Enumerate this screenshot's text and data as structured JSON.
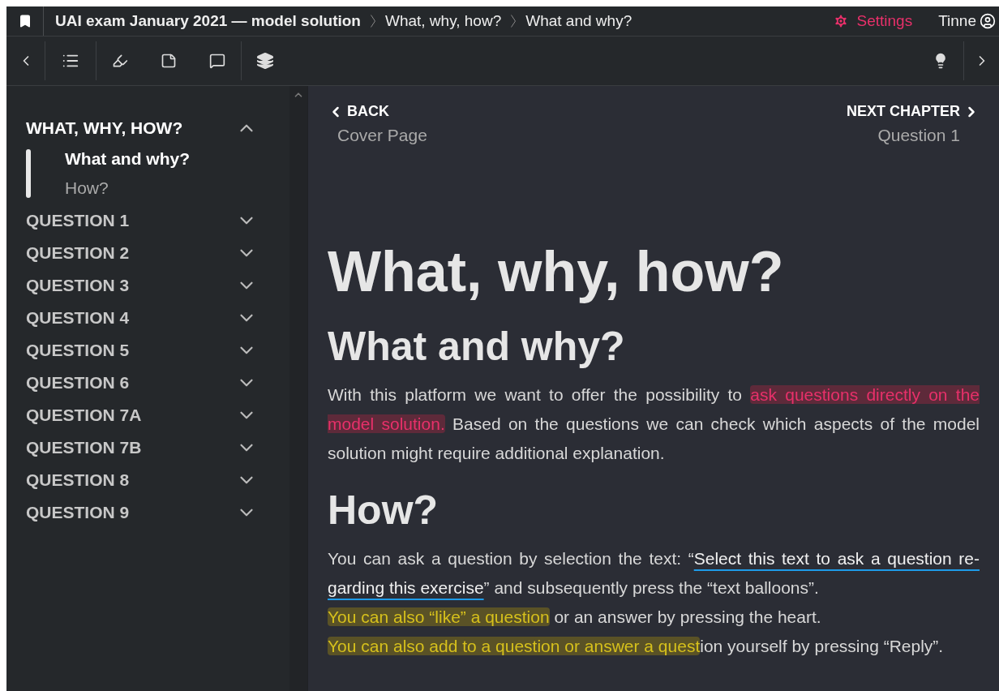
{
  "topbar": {
    "title": "UAI exam January 2021 — model solution",
    "breadcrumbs": [
      "What, why, how?",
      "What and why?"
    ],
    "settings": "Settings",
    "user": "Tinne"
  },
  "sidebar": {
    "sections": [
      {
        "label": "WHAT, WHY, HOW?",
        "expanded": true,
        "children": [
          {
            "label": "What and why?",
            "selected": true
          },
          {
            "label": "How?",
            "selected": false
          }
        ]
      },
      {
        "label": "QUESTION 1",
        "expanded": false
      },
      {
        "label": "QUESTION 2",
        "expanded": false
      },
      {
        "label": "QUESTION 3",
        "expanded": false
      },
      {
        "label": "QUESTION 4",
        "expanded": false
      },
      {
        "label": "QUESTION 5",
        "expanded": false
      },
      {
        "label": "QUESTION 6",
        "expanded": false
      },
      {
        "label": "QUESTION 7A",
        "expanded": false
      },
      {
        "label": "QUESTION 7B",
        "expanded": false
      },
      {
        "label": "QUESTION 8",
        "expanded": false
      },
      {
        "label": "QUESTION 9",
        "expanded": false
      }
    ]
  },
  "nav": {
    "back": "BACK",
    "back_target": "Cover Page",
    "next": "NEXT CHAPTER",
    "next_target": "Question 1"
  },
  "content": {
    "title": "What, why, how?",
    "blocks": [
      {
        "kind": "heading",
        "text": "What and why?"
      },
      {
        "kind": "paragraph",
        "lines": [
          [
            {
              "kind": "plain",
              "text": "With this platform we want to offer the possibility to "
            },
            {
              "kind": "question",
              "text": "ask questions directly on the model solution."
            },
            {
              "kind": "plain",
              "text": " Based on the questions we can check which aspects of the model solution might require additional explanation."
            }
          ]
        ]
      },
      {
        "kind": "heading",
        "text": "How?"
      },
      {
        "kind": "paragraph",
        "lines": [
          [
            {
              "kind": "plain",
              "text": "You can ask a question by selection the text: “"
            },
            {
              "kind": "selectable",
              "text": "Select this text to ask a question re-garding this exercise"
            },
            {
              "kind": "plain",
              "text": "” and subsequently press the “text balloons”."
            }
          ],
          [
            {
              "kind": "like",
              "text": "You can also “like” a question"
            },
            {
              "kind": "plain",
              "text": " or an answer by pressing the heart."
            }
          ],
          [
            {
              "kind": "like",
              "text": "You can also add to a question or answer a quest"
            },
            {
              "kind": "plain",
              "text": "ion yourself by pressing “Reply”."
            }
          ]
        ]
      }
    ]
  }
}
